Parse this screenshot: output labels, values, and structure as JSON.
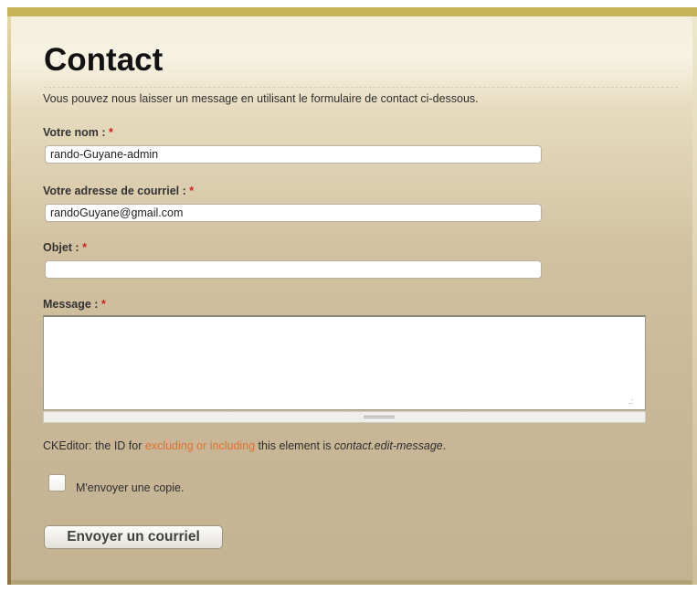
{
  "page": {
    "title": "Contact",
    "intro": "Vous pouvez nous laisser un message en utilisant le formulaire de contact ci-dessous."
  },
  "form": {
    "required_marker": "*",
    "name": {
      "label": "Votre nom :",
      "value": "rando-Guyane-admin"
    },
    "email": {
      "label": "Votre adresse de courriel :",
      "value": "randoGuyane@gmail.com"
    },
    "subject": {
      "label": "Objet :",
      "value": ""
    },
    "message": {
      "label": "Message :",
      "value": ""
    },
    "ckeditor_note": {
      "prefix": "CKEditor: the ID for ",
      "link_text": "excluding or including",
      "middle": " this element is ",
      "element_id": "contact.edit-message",
      "suffix": "."
    },
    "copy_checkbox": {
      "label": "M'envoyer une copie.",
      "checked": false
    },
    "submit_label": "Envoyer un courriel"
  },
  "colors": {
    "accent_link": "#e07330",
    "required": "#cc2222",
    "top_band": "#c7b35a"
  },
  "icons": {
    "resize": "resize-grip-icon",
    "textarea_handle": "drag-handle-icon"
  }
}
